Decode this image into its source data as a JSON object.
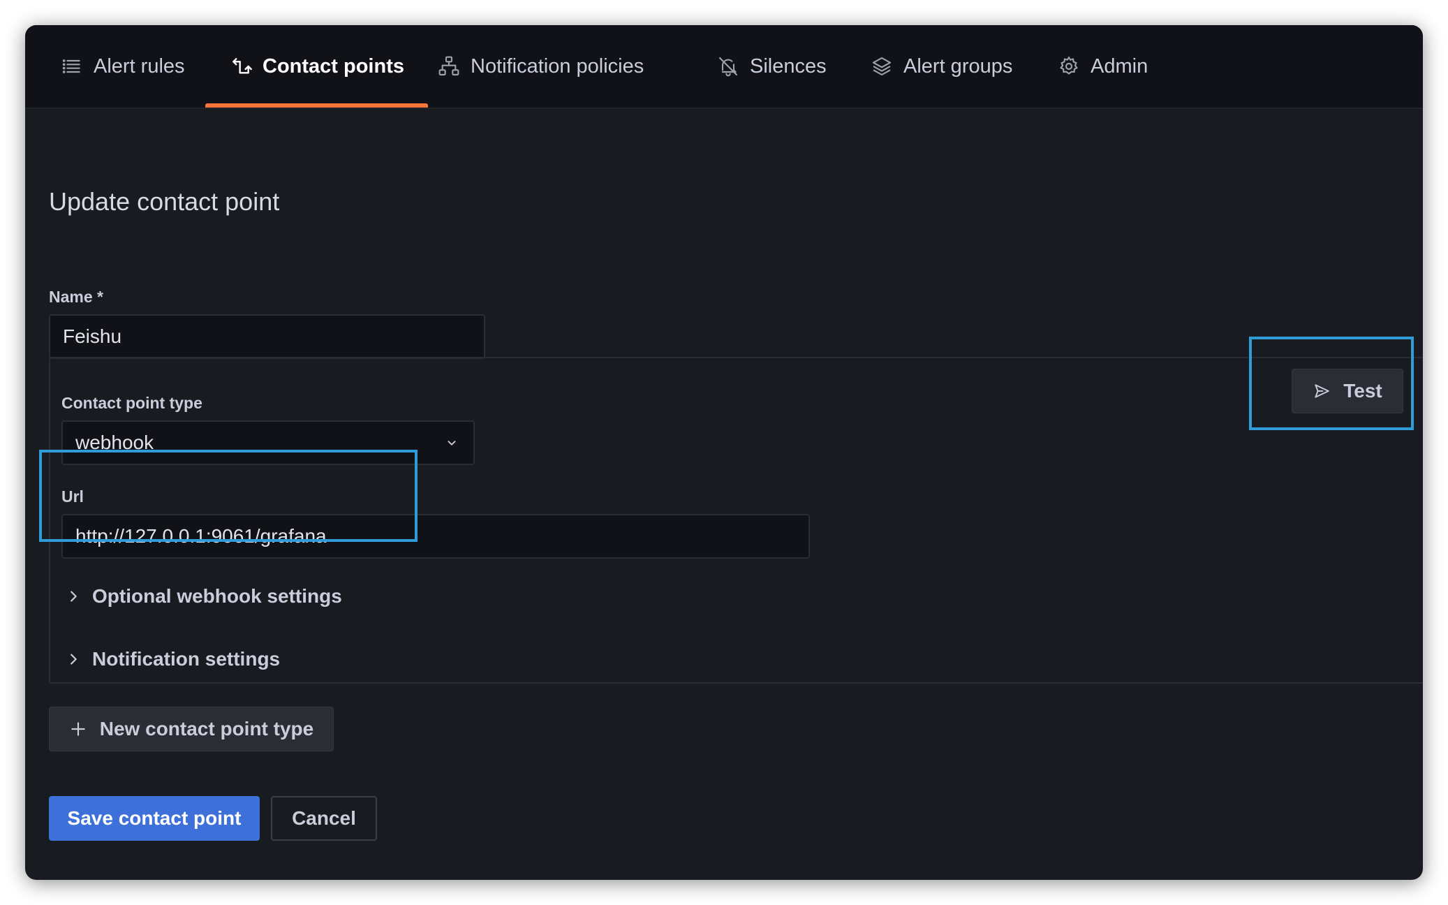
{
  "nav": {
    "tabs": [
      {
        "label": "Alert rules",
        "icon": "list-icon"
      },
      {
        "label": "Contact points",
        "icon": "contact-points-icon",
        "active": true
      },
      {
        "label": "Notification policies",
        "icon": "sitemap-icon"
      },
      {
        "label": "Silences",
        "icon": "bell-slash-icon"
      },
      {
        "label": "Alert groups",
        "icon": "layer-group-icon"
      },
      {
        "label": "Admin",
        "icon": "cog-icon"
      }
    ],
    "active_color": "#f5763b"
  },
  "page": {
    "title": "Update contact point"
  },
  "form": {
    "name_label": "Name *",
    "name_value": "Feishu",
    "contact_type_label": "Contact point type",
    "contact_type_value": "webhook",
    "url_label": "Url",
    "url_value": "http://127.0.0.1:9061/grafana",
    "optional_settings": "Optional webhook settings",
    "notification_settings": "Notification settings",
    "test_label": "Test",
    "new_type_label": "New contact point type",
    "save_label": "Save contact point",
    "cancel_label": "Cancel"
  },
  "colors": {
    "background": "#181b1f",
    "primary": "#3d71d9",
    "highlight": "#2f9bd8"
  }
}
